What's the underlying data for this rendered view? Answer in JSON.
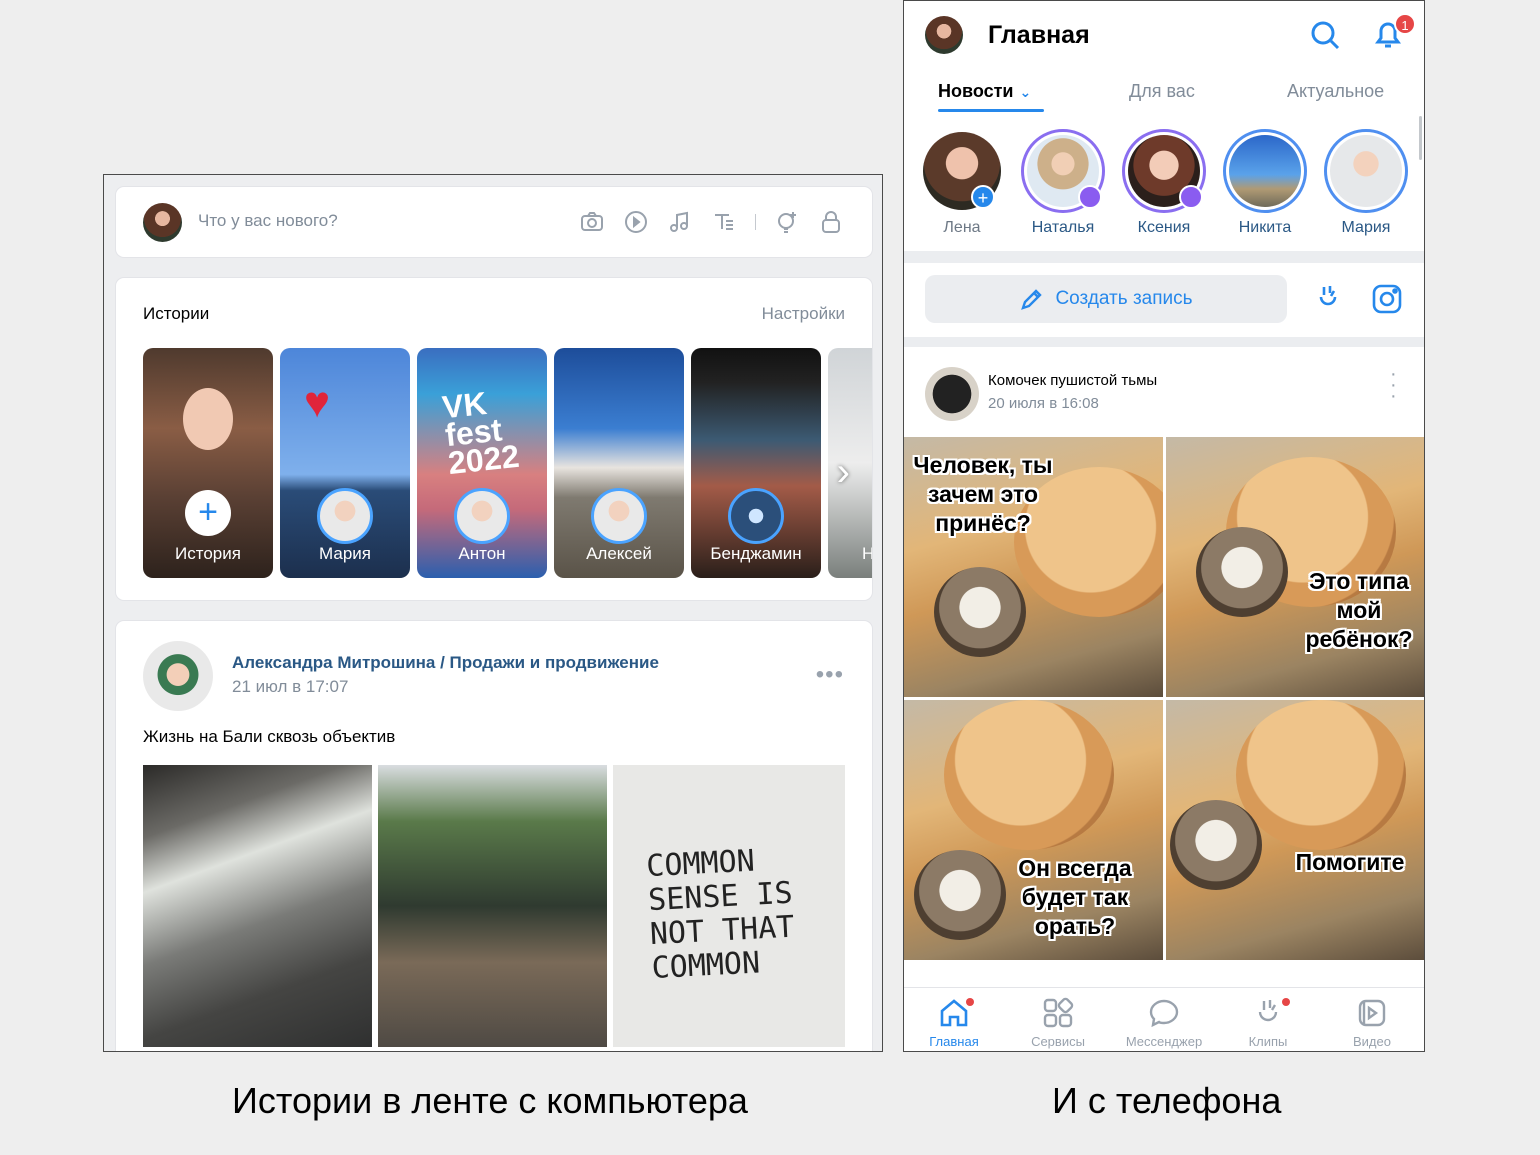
{
  "desktop": {
    "compose_placeholder": "Что у вас нового?",
    "tool_icons": [
      "camera-icon",
      "video-icon",
      "music-icon",
      "text-icon",
      "idea-icon",
      "lock-icon"
    ],
    "stories": {
      "title": "Истории",
      "settings": "Настройки",
      "items": [
        {
          "label": "История"
        },
        {
          "label": "Мария"
        },
        {
          "label": "Антон"
        },
        {
          "label": "Алексей"
        },
        {
          "label": "Бенджамин"
        },
        {
          "label": "Н"
        }
      ],
      "vk_fest_text": "VK fest 2022"
    },
    "post": {
      "author": "Александра Митрошина / Продажи и продвижение",
      "date": "21 июл в 17:07",
      "text": "Жизнь на Бали сквозь объектив",
      "wall_text": "COMMON SENSE IS NOT THAT COMMON"
    }
  },
  "mobile": {
    "title": "Главная",
    "notification_count": "1",
    "tabs": [
      {
        "label": "Новости",
        "active": true
      },
      {
        "label": "Для вас",
        "active": false
      },
      {
        "label": "Актуальное",
        "active": false
      }
    ],
    "stories": [
      "Лена",
      "Наталья",
      "Ксения",
      "Никита",
      "Мария"
    ],
    "create_post": "Создать запись",
    "post": {
      "author": "Комочек пушистой тьмы",
      "date": "20 июля в 16:08",
      "captions": [
        "Человек, ты зачем это принёс?",
        "Это типа мой ребёнок?",
        "Он всегда будет так орать?",
        "Помогите"
      ]
    },
    "bottom_nav": [
      {
        "label": "Главная",
        "icon": "home-icon",
        "active": true
      },
      {
        "label": "Сервисы",
        "icon": "services-icon",
        "active": false
      },
      {
        "label": "Мессенджер",
        "icon": "messenger-icon",
        "active": false
      },
      {
        "label": "Клипы",
        "icon": "clips-icon",
        "active": false
      },
      {
        "label": "Видео",
        "icon": "video-icon",
        "active": false
      }
    ]
  },
  "captions": {
    "left": "Истории в ленте с компьютера",
    "right": "И с телефона"
  },
  "colors": {
    "accent": "#2688eb",
    "link": "#2a5885",
    "muted": "#818c99",
    "badge": "#e64646",
    "background": "#eeeeee"
  }
}
